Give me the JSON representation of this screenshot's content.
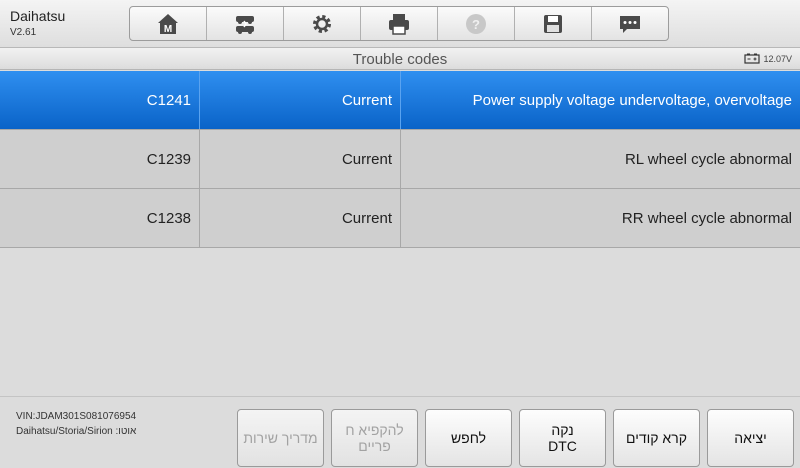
{
  "header": {
    "brand": "Daihatsu",
    "version": "V2.61",
    "toolbar": [
      {
        "icon": "home-m-icon"
      },
      {
        "icon": "vehicle-swap-icon"
      },
      {
        "icon": "gear-icon"
      },
      {
        "icon": "printer-icon"
      },
      {
        "icon": "help-icon",
        "disabled": true
      },
      {
        "icon": "save-icon"
      },
      {
        "icon": "message-icon"
      }
    ]
  },
  "subheader": {
    "title": "Trouble codes",
    "battery_voltage": "12.07V"
  },
  "codes": [
    {
      "code": "C1241",
      "status": "Current",
      "description": "Power supply voltage undervoltage, overvoltage",
      "selected": true
    },
    {
      "code": "C1239",
      "status": "Current",
      "description": "RL wheel cycle abnormal",
      "selected": false
    },
    {
      "code": "C1238",
      "status": "Current",
      "description": "RR wheel cycle abnormal",
      "selected": false
    }
  ],
  "footer": {
    "vin": "VIN:JDAM301S081076954",
    "vehicle": "Daihatsu/Storia/Sirion :אוטו",
    "buttons": {
      "service_guide": "מדריך שירות",
      "freeze_frame": "להקפיא ח\nפריים",
      "search": "לחפש",
      "clear_dtc": "נקה\nDTC",
      "read_codes": "קרא קודים",
      "exit": "יציאה"
    }
  },
  "colors": {
    "selected_row": "#1a78e0",
    "row_bg": "#cfcfcf",
    "background": "#dcdcdc"
  }
}
